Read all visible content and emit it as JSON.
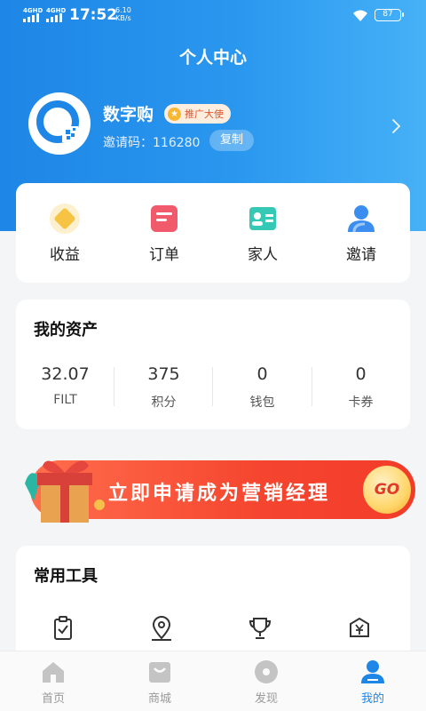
{
  "status_bar": {
    "signal_1": "4GHD",
    "signal_2": "4GHD",
    "time": "17:52",
    "net_speed": "6.10",
    "net_speed_unit": "KB/s",
    "battery": "87"
  },
  "header": {
    "title": "个人中心"
  },
  "profile": {
    "name": "数字购",
    "badge": "推广大使",
    "invite_label": "邀请码：116280",
    "copy_label": "复制"
  },
  "quick_actions": [
    {
      "label": "收益",
      "icon": "diamond-icon",
      "color": "#f6c342"
    },
    {
      "label": "订单",
      "icon": "order-icon",
      "color": "#f05a6a"
    },
    {
      "label": "家人",
      "icon": "family-card-icon",
      "color": "#35c9b5"
    },
    {
      "label": "邀请",
      "icon": "invite-user-icon",
      "color": "#3b8ef0"
    }
  ],
  "assets": {
    "title": "我的资产",
    "items": [
      {
        "value": "32.07",
        "label": "FILT"
      },
      {
        "value": "375",
        "label": "积分"
      },
      {
        "value": "0",
        "label": "钱包"
      },
      {
        "value": "0",
        "label": "卡券"
      }
    ]
  },
  "promo": {
    "text": "立即申请成为营销经理",
    "go_label": "GO"
  },
  "tools": {
    "title": "常用工具",
    "items": [
      {
        "icon": "clipboard-check-icon"
      },
      {
        "icon": "location-pin-icon"
      },
      {
        "icon": "trophy-icon"
      },
      {
        "icon": "coupon-yuan-icon"
      }
    ]
  },
  "tabbar": {
    "items": [
      {
        "label": "首页",
        "icon": "home-icon"
      },
      {
        "label": "商城",
        "icon": "shop-icon"
      },
      {
        "label": "发现",
        "icon": "discover-icon"
      },
      {
        "label": "我的",
        "icon": "profile-icon",
        "active": true
      }
    ]
  },
  "colors": {
    "primary": "#1e86e6",
    "promo": "#f5452f",
    "badge_text": "#e0542b"
  }
}
